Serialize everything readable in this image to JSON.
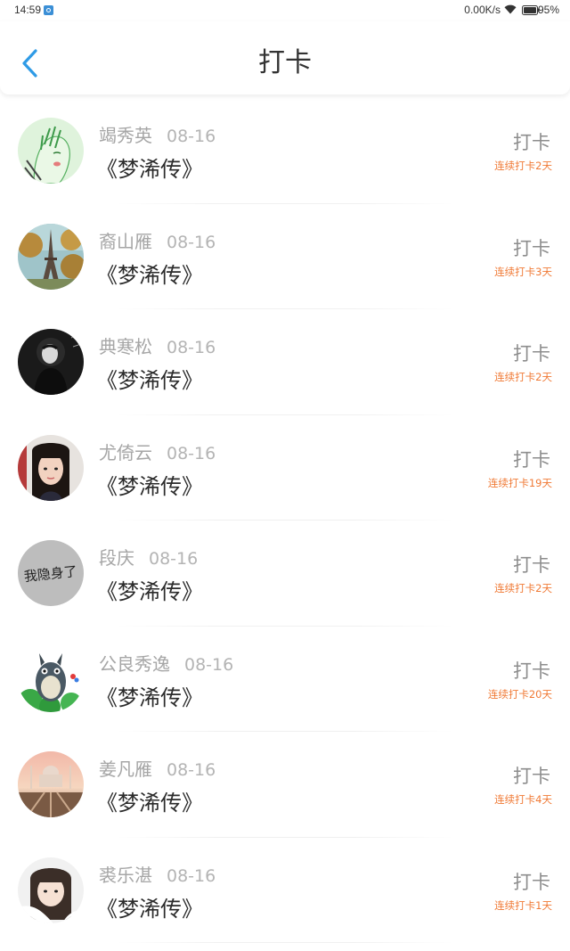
{
  "status_bar": {
    "time": "14:59",
    "net_speed": "0.00K/s",
    "battery": "95%",
    "icons": [
      "notification-icon",
      "wifi-icon",
      "battery-icon"
    ]
  },
  "header": {
    "title": "打卡",
    "back_icon": "chevron-left-icon",
    "accent_color": "#2f9be6"
  },
  "records": [
    {
      "name": "竭秀英",
      "date": "08-16",
      "book": "《梦浠传》",
      "action": "打卡",
      "streak": "连续打卡2天",
      "avatar": "green-sketch-woman"
    },
    {
      "name": "裔山雁",
      "date": "08-16",
      "book": "《梦浠传》",
      "action": "打卡",
      "streak": "连续打卡3天",
      "avatar": "eiffel-tower"
    },
    {
      "name": "典寒松",
      "date": "08-16",
      "book": "《梦浠传》",
      "action": "打卡",
      "streak": "连续打卡2天",
      "avatar": "dark-portrait"
    },
    {
      "name": "尤倚云",
      "date": "08-16",
      "book": "《梦浠传》",
      "action": "打卡",
      "streak": "连续打卡19天",
      "avatar": "girl-selfie"
    },
    {
      "name": "段庆",
      "date": "08-16",
      "book": "《梦浠传》",
      "action": "打卡",
      "streak": "连续打卡2天",
      "avatar": "text-avatar",
      "avatar_text": "我隐身了"
    },
    {
      "name": "公良秀逸",
      "date": "08-16",
      "book": "《梦浠传》",
      "action": "打卡",
      "streak": "连续打卡20天",
      "avatar": "totoro"
    },
    {
      "name": "姜凡雁",
      "date": "08-16",
      "book": "《梦浠传》",
      "action": "打卡",
      "streak": "连续打卡4天",
      "avatar": "taj-mahal"
    },
    {
      "name": "裘乐湛",
      "date": "08-16",
      "book": "《梦浠传》",
      "action": "打卡",
      "streak": "连续打卡1天",
      "avatar": "girl-light"
    }
  ],
  "colors": {
    "name": "#a6a6a6",
    "book": "#2b2b2b",
    "action": "#8d8d8d",
    "streak": "#f07a36"
  }
}
